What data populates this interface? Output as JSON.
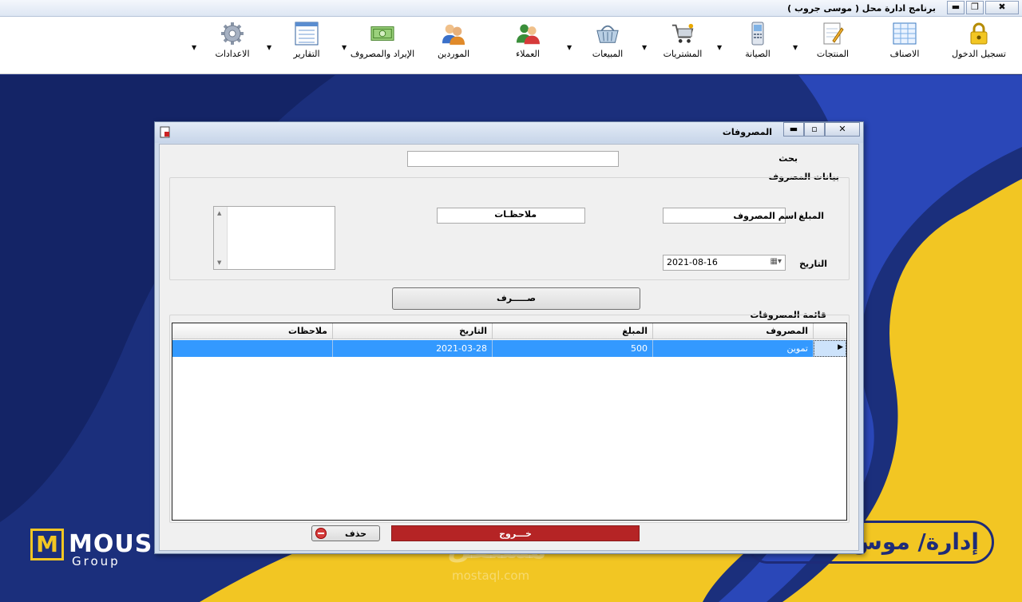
{
  "window": {
    "title": "برنامج ادارة محل ( موسى جروب )",
    "minimize": "▬",
    "maximize": "❐",
    "close": "✖"
  },
  "toolbar": {
    "items": [
      {
        "label": "تسجيل الدخول",
        "icon": "lock-icon"
      },
      {
        "label": "الاصناف",
        "icon": "grid-icon"
      },
      {
        "label": "المنتجات",
        "icon": "notepad-icon"
      },
      {
        "label": "الصيانة",
        "icon": "phone-icon"
      },
      {
        "label": "المشتريات",
        "icon": "cart-icon"
      },
      {
        "label": "المبيعات",
        "icon": "basket-icon"
      },
      {
        "label": "العملاء",
        "icon": "customers-icon"
      },
      {
        "label": "الموردين",
        "icon": "suppliers-icon"
      },
      {
        "label": "الإيراد والمصروف",
        "icon": "money-icon"
      },
      {
        "label": "التقارير",
        "icon": "report-icon"
      },
      {
        "label": "الاعدادات",
        "icon": "gear-icon"
      }
    ],
    "dropdown_arrow": "▼"
  },
  "branding": {
    "left_logo_letter": "M",
    "left_logo_text": "MOUS",
    "left_logo_sub": "Group",
    "right_logo_text": "إدارة/ موس",
    "watermark": "مستقل",
    "watermark_url": "mostaql.com"
  },
  "dialog": {
    "title": "المصروفات",
    "controls": {
      "minimize": "▬",
      "maximize": "▫",
      "close": "✕"
    },
    "search": {
      "label": "بحث",
      "value": ""
    },
    "group_title": "بيانات المصروف",
    "amount": {
      "label": "المبلغ",
      "value": ""
    },
    "expense_name": {
      "label": "اسم المصروف",
      "value": ""
    },
    "notes": {
      "label": "ملاحظـات",
      "value": ""
    },
    "date": {
      "label": "التاريخ",
      "value": "2021-08-16"
    },
    "spend_button": "صـــــرف",
    "list_title": "قائمة المصروفات",
    "grid": {
      "columns": [
        "المصروف",
        "المبلغ",
        "التاريخ",
        "ملاحظات"
      ],
      "rows": [
        {
          "expense": "تموين",
          "amount": "500",
          "date": "2021-03-28",
          "notes": ""
        }
      ],
      "current_row_marker": "▶"
    },
    "exit_button": "خـــروج",
    "delete_button": "حذف"
  },
  "colors": {
    "dark_blue": "#1b2f7c",
    "yellow": "#f2c623",
    "exit_red": "#b52425",
    "selection_blue": "#3399ff"
  }
}
